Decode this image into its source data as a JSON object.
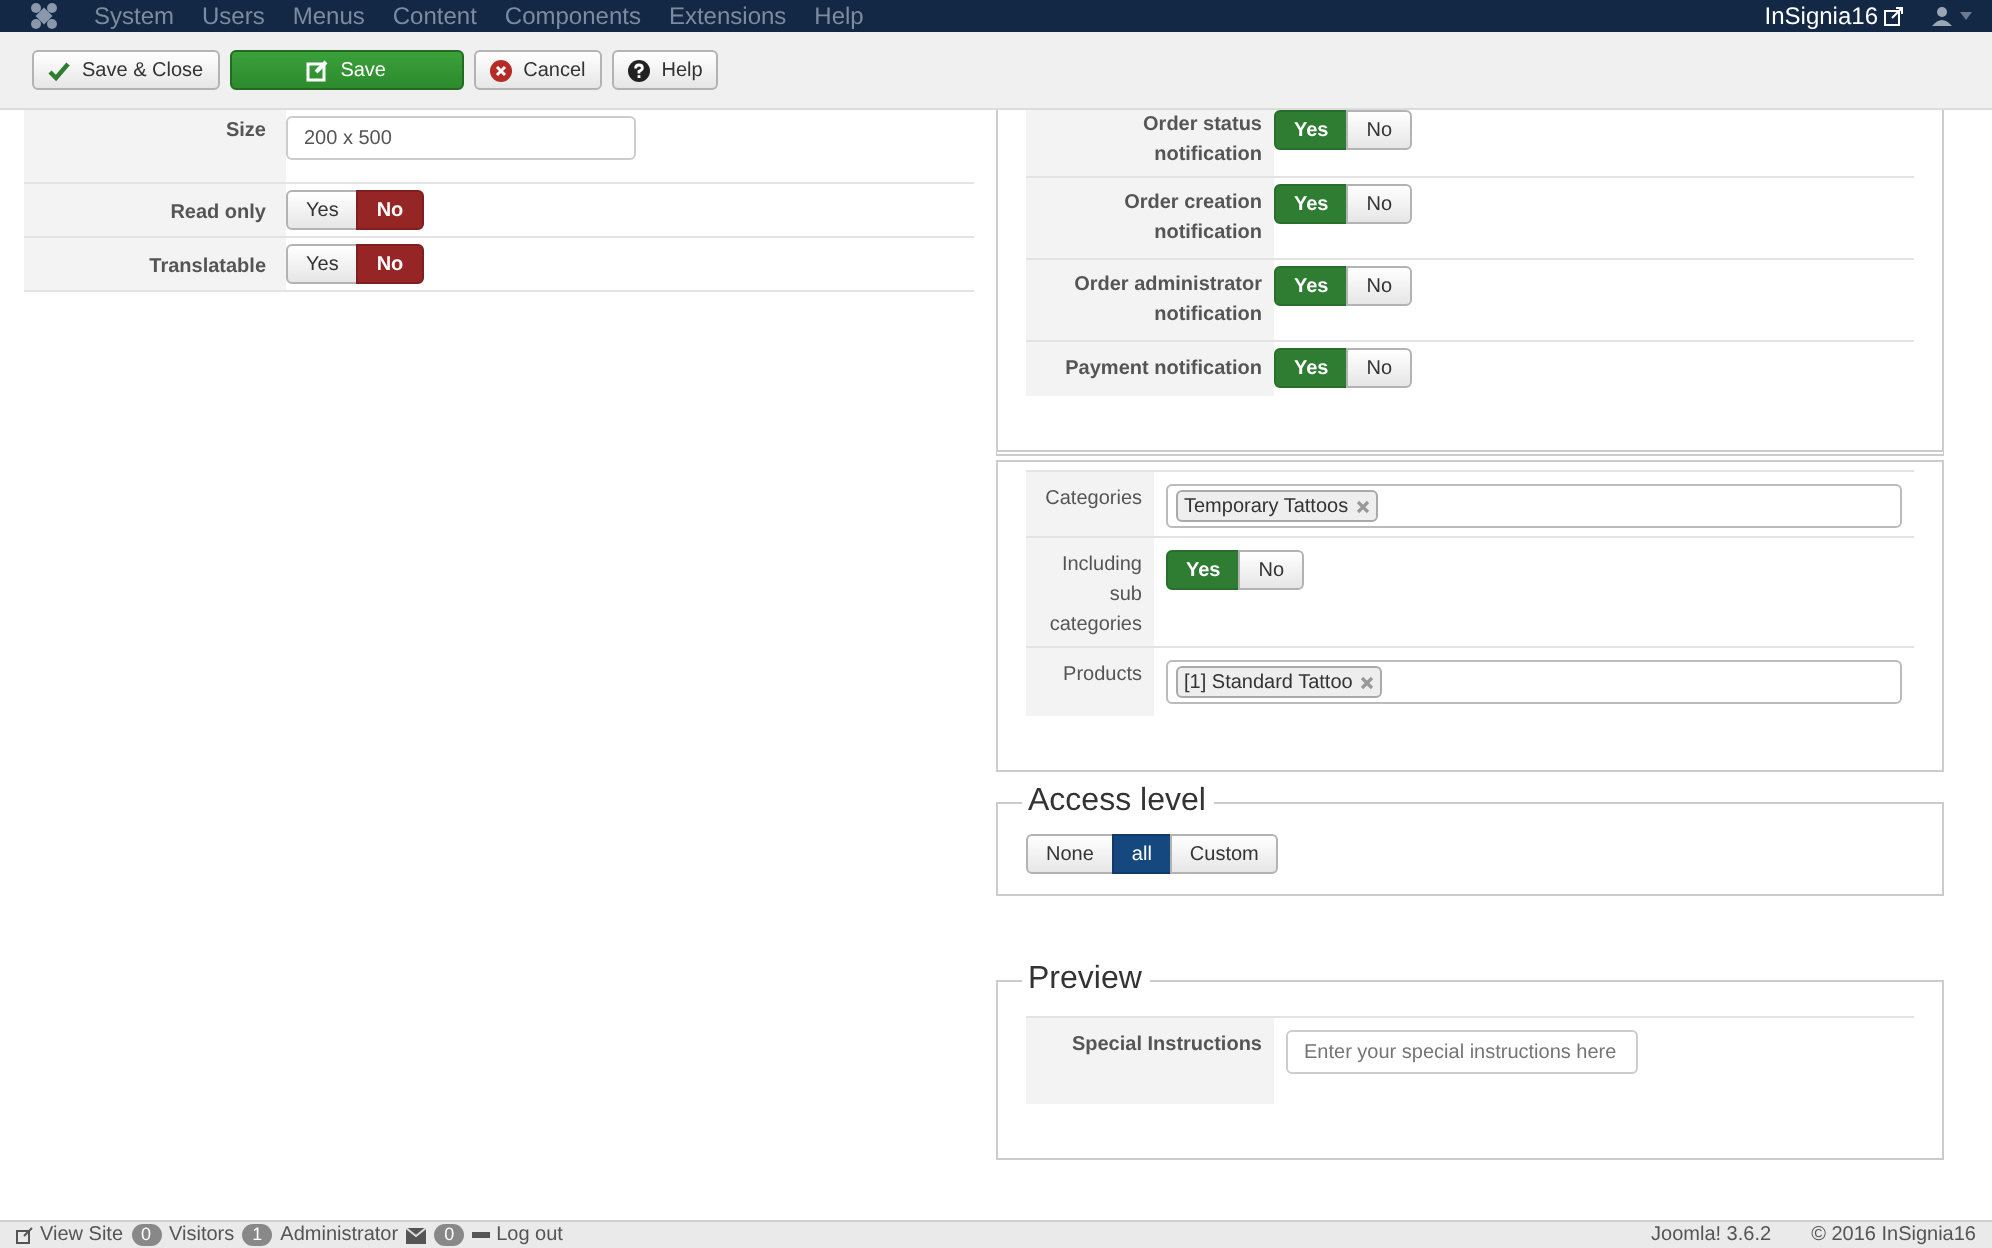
{
  "navbar": {
    "menu": [
      "System",
      "Users",
      "Menus",
      "Content",
      "Components",
      "Extensions",
      "Help"
    ],
    "site_name": "InSignia16"
  },
  "toolbar": [
    {
      "label": "Save & Close",
      "kind": "save-close"
    },
    {
      "label": "Save",
      "kind": "save"
    },
    {
      "label": "Cancel",
      "kind": "cancel"
    },
    {
      "label": "Help",
      "kind": "help"
    }
  ],
  "left_fields": [
    {
      "label": "Size",
      "kind": "text",
      "value": "200 x 500"
    },
    {
      "label": "Read only",
      "kind": "toggle",
      "options": [
        {
          "label": "Yes",
          "selected": false
        },
        {
          "label": "No",
          "selected": true
        }
      ]
    },
    {
      "label": "Translatable",
      "kind": "toggle",
      "options": [
        {
          "label": "Yes",
          "selected": false
        },
        {
          "label": "No",
          "selected": true
        }
      ]
    }
  ],
  "notifications": [
    {
      "label": "Order status notification",
      "kind": "toggle",
      "options": [
        {
          "label": "Yes",
          "selected": true
        },
        {
          "label": "No",
          "selected": false
        }
      ]
    },
    {
      "label": "Order creation notification",
      "kind": "toggle",
      "options": [
        {
          "label": "Yes",
          "selected": true
        },
        {
          "label": "No",
          "selected": false
        }
      ]
    },
    {
      "label": "Order administrator notification",
      "kind": "toggle",
      "options": [
        {
          "label": "Yes",
          "selected": true
        },
        {
          "label": "No",
          "selected": false
        }
      ]
    },
    {
      "label": "Payment notification",
      "kind": "toggle",
      "options": [
        {
          "label": "Yes",
          "selected": true
        },
        {
          "label": "No",
          "selected": false
        }
      ]
    }
  ],
  "filters": [
    {
      "label": "Categories",
      "kind": "tags",
      "tags": [
        "Temporary Tattoos"
      ]
    },
    {
      "label": "Including sub categories",
      "kind": "toggle",
      "options": [
        {
          "label": "Yes",
          "selected": true
        },
        {
          "label": "No",
          "selected": false
        }
      ]
    },
    {
      "label": "Products",
      "kind": "tags",
      "tags": [
        "[1] Standard Tattoo"
      ]
    }
  ],
  "access_level": {
    "legend": "Access level",
    "options": [
      {
        "label": "None",
        "selected": false
      },
      {
        "label": "all",
        "selected": true
      },
      {
        "label": "Custom",
        "selected": false
      }
    ]
  },
  "preview": {
    "legend": "Preview",
    "fields": [
      {
        "label": "Special Instructions",
        "placeholder": "Enter your special instructions here"
      }
    ]
  },
  "status_bar": {
    "left": [
      {
        "kind": "link",
        "label": "View Site"
      },
      {
        "kind": "badge",
        "label": "0"
      },
      {
        "kind": "text",
        "label": "Visitors"
      },
      {
        "kind": "badge",
        "label": "1"
      },
      {
        "kind": "text",
        "label": "Administrator"
      },
      {
        "kind": "mail"
      },
      {
        "kind": "badge",
        "label": "0"
      },
      {
        "kind": "logout",
        "label": "Log out"
      }
    ],
    "right": [
      "Joomla! 3.6.2",
      "© 2016 InSignia16"
    ]
  }
}
